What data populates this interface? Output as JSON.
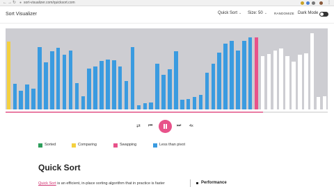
{
  "browser": {
    "url": "sort-visualizer.com/quicksort.com"
  },
  "header": {
    "title": "Sort Visualizer",
    "algorithm_value": "Quick Sort",
    "size_label": "Size",
    "size_value": "50",
    "randomize_label": "RANDOMIZE",
    "dark_mode_label": "Dark Mode",
    "dark_mode_on": false
  },
  "visualizer": {
    "progress": 0.8,
    "colors": {
      "background": "#cdcdd2",
      "sorted": "#2e9e5b",
      "comparing": "#f4d03f",
      "swapping": "#e8528a",
      "less_than_pivot": "#3a9be0",
      "default": "#ffffff"
    },
    "bar_values": [
      0.87,
      0.33,
      0.24,
      0.32,
      0.27,
      0.8,
      0.6,
      0.74,
      0.79,
      0.7,
      0.75,
      0.34,
      0.17,
      0.52,
      0.55,
      0.62,
      0.64,
      0.63,
      0.55,
      0.36,
      0.8,
      0.05,
      0.08,
      0.09,
      0.58,
      0.44,
      0.51,
      0.74,
      0.12,
      0.13,
      0.16,
      0.19,
      0.47,
      0.58,
      0.73,
      0.84,
      0.88,
      0.75,
      0.88,
      0.92,
      0.92,
      0.68,
      0.71,
      0.75,
      0.78,
      0.68,
      0.61,
      0.7,
      0.72,
      0.97,
      0.16,
      0.17
    ],
    "bar_states": [
      "comparing",
      "less",
      "less",
      "less",
      "less",
      "less",
      "less",
      "less",
      "less",
      "less",
      "less",
      "less",
      "less",
      "less",
      "less",
      "less",
      "less",
      "less",
      "less",
      "less",
      "less",
      "less",
      "less",
      "less",
      "less",
      "less",
      "less",
      "less",
      "less",
      "less",
      "less",
      "less",
      "less",
      "less",
      "less",
      "less",
      "less",
      "less",
      "less",
      "less",
      "swapping",
      "default",
      "default",
      "default",
      "default",
      "default",
      "default",
      "default",
      "default",
      "default",
      "default",
      "default"
    ]
  },
  "controls": {
    "shuffle_icon": "⇄",
    "prev_icon": "⏮",
    "next_icon": "⏭",
    "speed_label": "4x"
  },
  "legend": [
    {
      "label": "Sorted",
      "color": "#2e9e5b"
    },
    {
      "label": "Comparing",
      "color": "#f4d03f"
    },
    {
      "label": "Swapping",
      "color": "#e8528a"
    },
    {
      "label": "Less than pivot",
      "color": "#3a9be0"
    }
  ],
  "content": {
    "heading": "Quick Sort",
    "desc_link": "Quick Sort",
    "desc_rest": " is an efficient, in-place sorting algorithm that in practice is faster",
    "performance_title": "Performance"
  }
}
